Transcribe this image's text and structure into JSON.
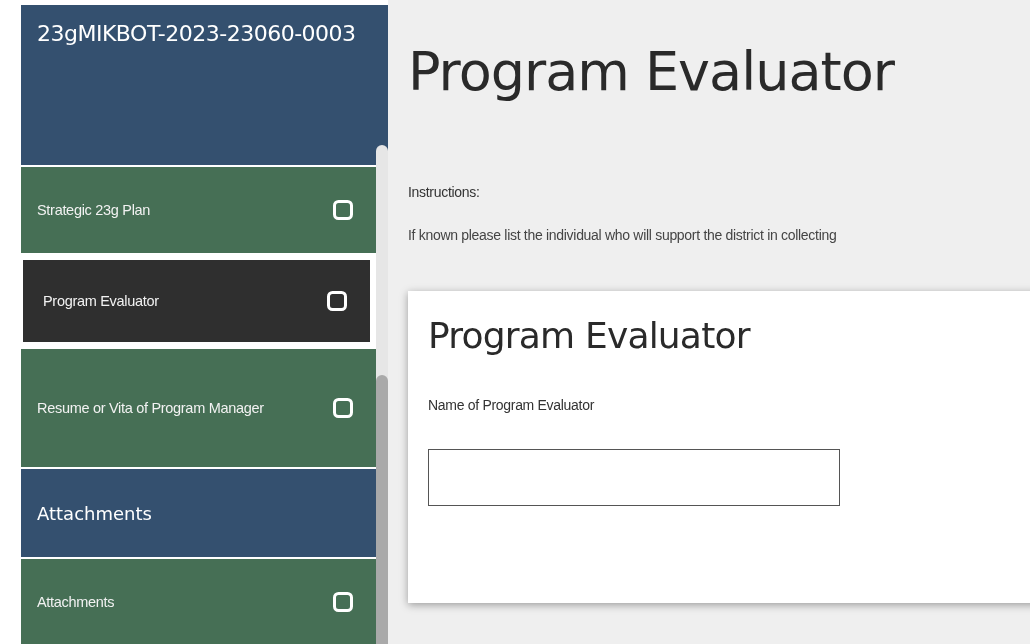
{
  "sidebar": {
    "title": "23gMIKBOT-2023-23060-0003",
    "items": [
      {
        "kind": "step",
        "label": "Strategic 23g Plan",
        "selected": false,
        "checked": false
      },
      {
        "kind": "step",
        "label": "Program Evaluator",
        "selected": true,
        "checked": false
      },
      {
        "kind": "step",
        "label": "Resume or Vita of Program Manager",
        "selected": false,
        "checked": false
      },
      {
        "kind": "section",
        "label": "Attachments"
      },
      {
        "kind": "step",
        "label": "Attachments",
        "selected": false,
        "checked": false
      }
    ]
  },
  "main": {
    "title": "Program Evaluator",
    "instructions_label": "Instructions:",
    "instructions_text": "If known please list the individual who will support the district in collecting",
    "card": {
      "title": "Program Evaluator",
      "field_label": "Name of Program Evaluator"
    }
  }
}
